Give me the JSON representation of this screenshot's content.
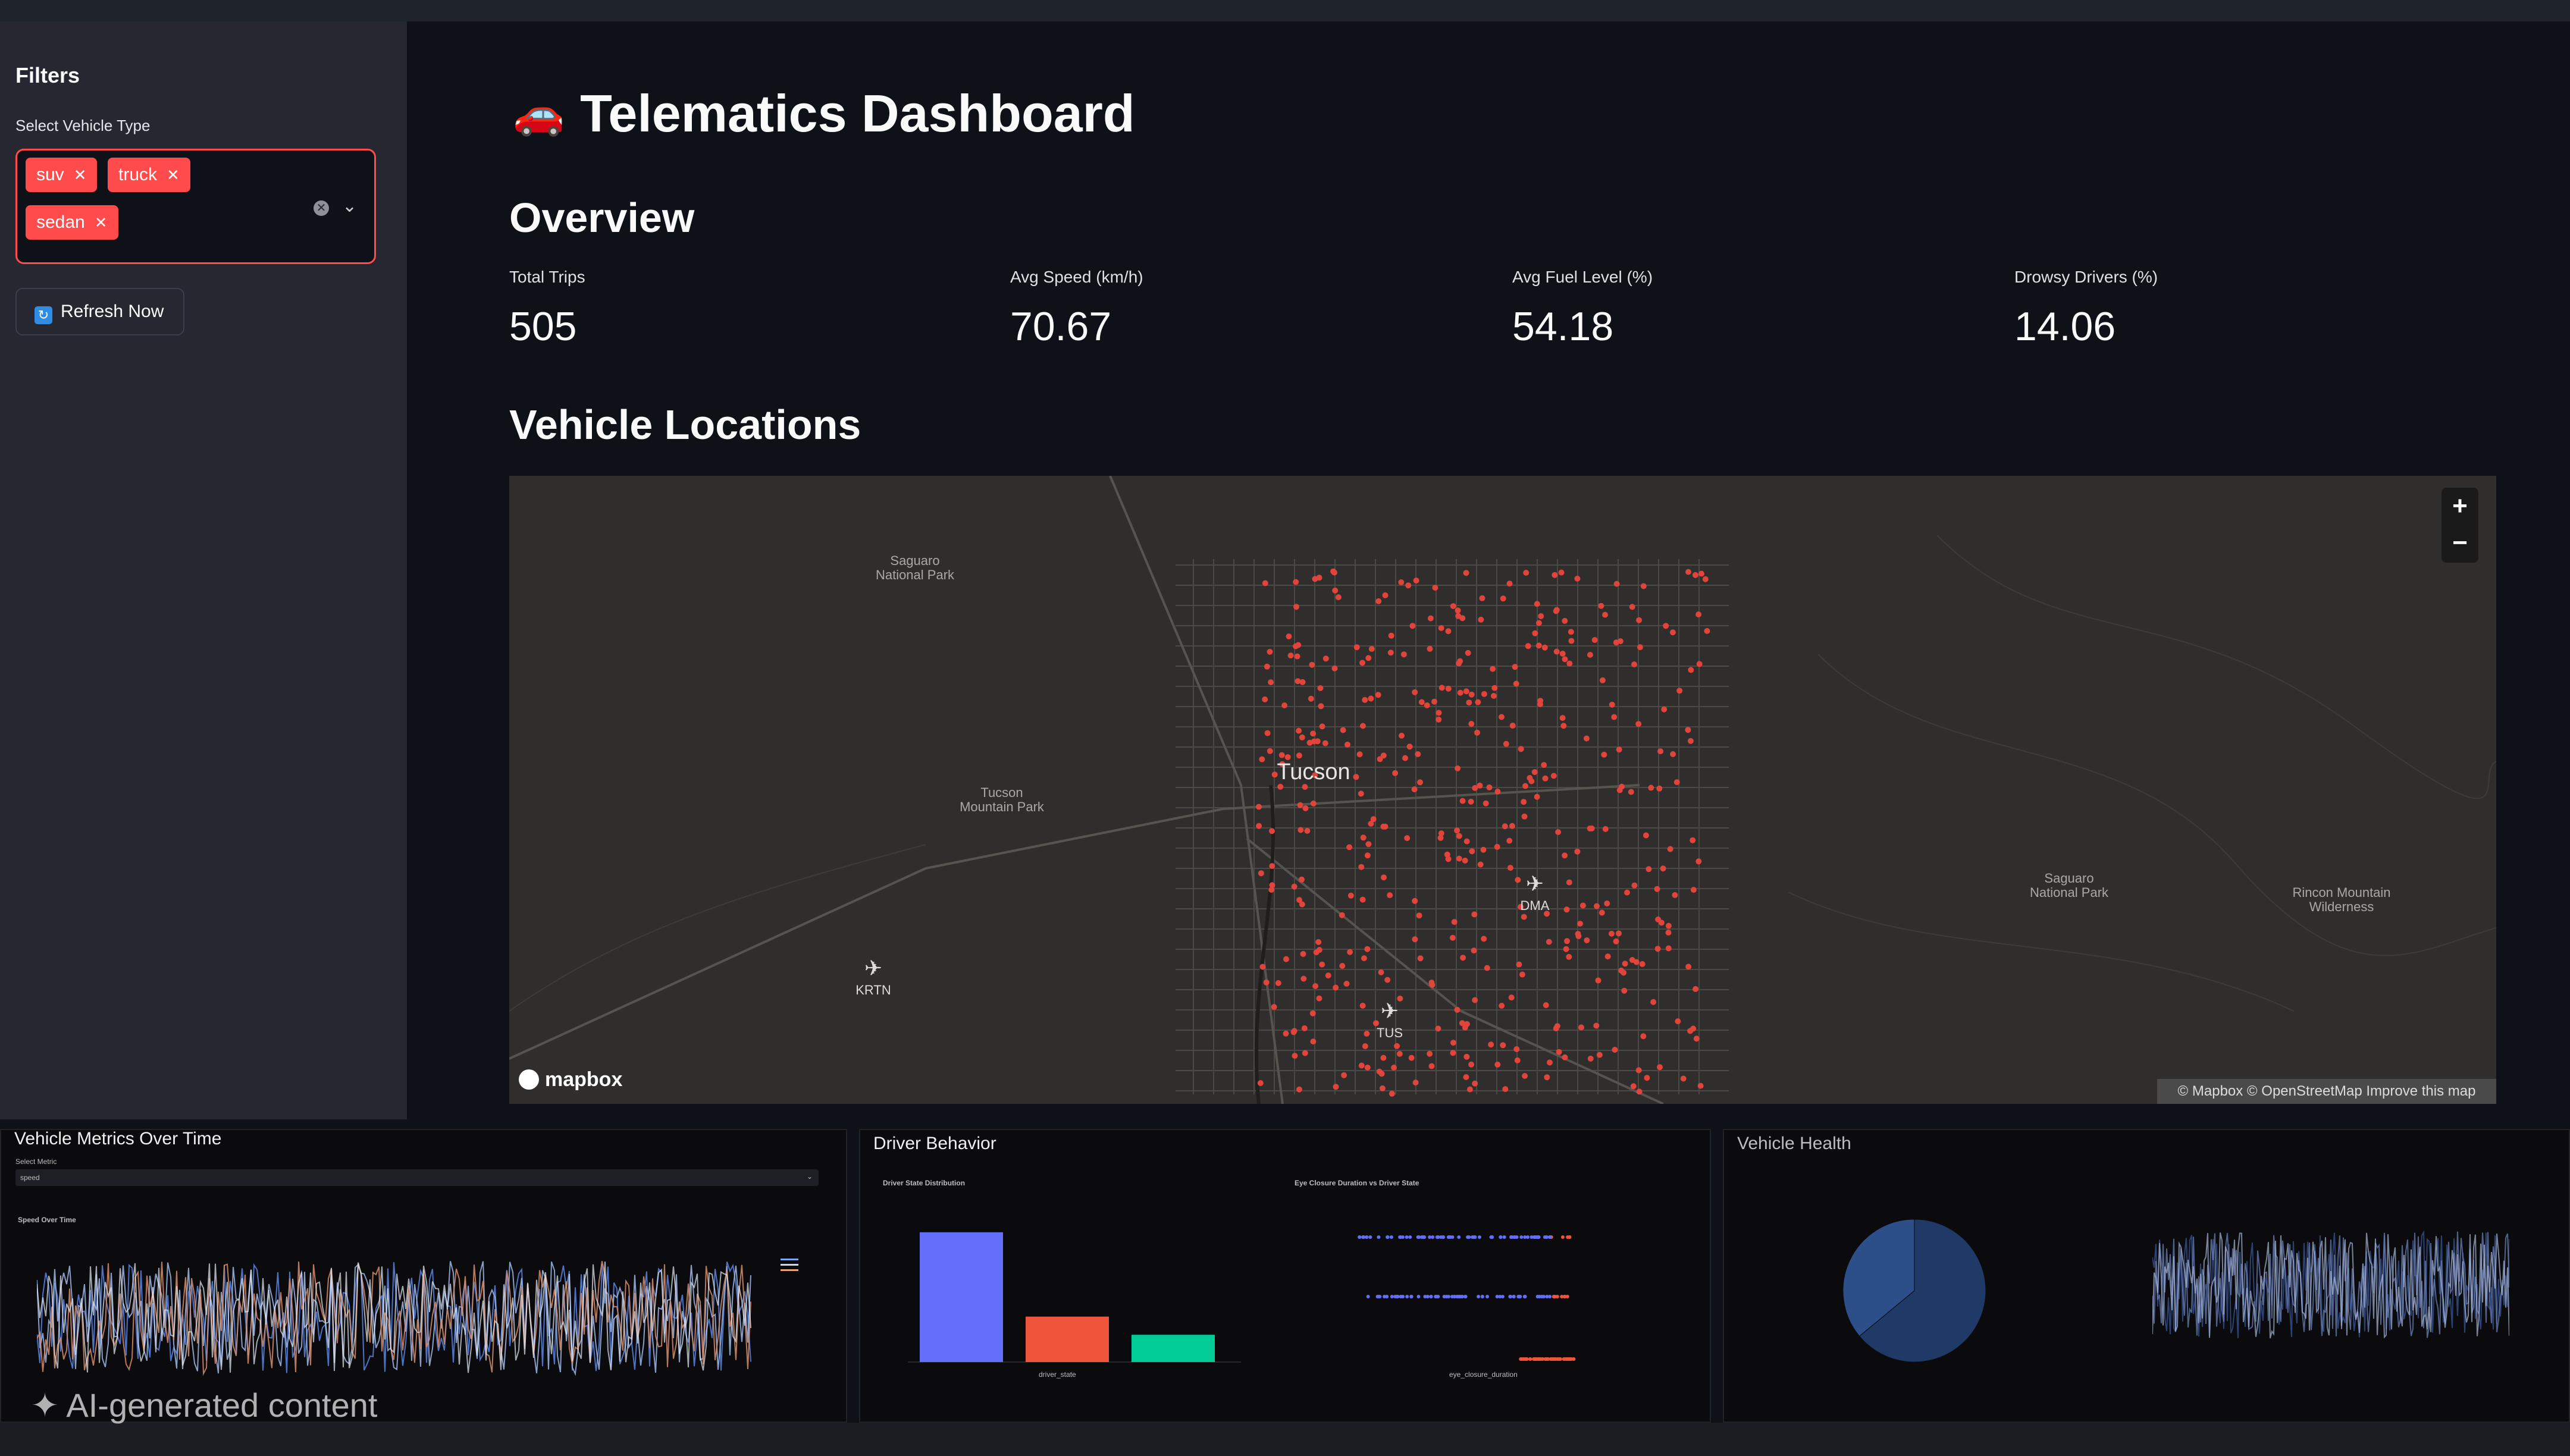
{
  "sidebar": {
    "title": "Filters",
    "select_label": "Select Vehicle Type",
    "selected_tags": [
      "suv",
      "truck",
      "sedan"
    ],
    "refresh_label": "Refresh Now"
  },
  "main": {
    "title": "Telematics Dashboard",
    "overview_heading": "Overview",
    "metrics": [
      {
        "label": "Total Trips",
        "value": "505"
      },
      {
        "label": "Avg Speed (km/h)",
        "value": "70.67"
      },
      {
        "label": "Avg Fuel Level (%)",
        "value": "54.18"
      },
      {
        "label": "Drowsy Drivers (%)",
        "value": "14.06"
      }
    ],
    "locations_heading": "Vehicle Locations"
  },
  "map": {
    "city": "Tucson",
    "places": [
      {
        "name": "Saguaro National Park",
        "lines": [
          "Saguaro",
          "National Park"
        ]
      },
      {
        "name": "Tucson Mountain Park",
        "lines": [
          "Tucson",
          "Mountain Park"
        ]
      },
      {
        "name": "Saguaro National Park",
        "lines": [
          "Saguaro",
          "National Park"
        ]
      },
      {
        "name": "Rincon Mountain Wilderness",
        "lines": [
          "Rincon Mountain",
          "Wilderness"
        ]
      }
    ],
    "airports": [
      "KRTN",
      "DMA",
      "TUS"
    ],
    "attribution": "© Mapbox © OpenStreetMap Improve this map",
    "logo": "mapbox",
    "zoom_in": "+",
    "zoom_out": "−",
    "point_color": "#e0443a"
  },
  "panels": {
    "metrics_over_time": {
      "title": "Vehicle Metrics Over Time",
      "select_label": "Select Metric",
      "select_value": "speed",
      "chart_title": "Speed Over Time"
    },
    "driver_behavior": {
      "title": "Driver Behavior",
      "left_chart_title": "Driver State Distribution",
      "right_chart_title": "Eye Closure Duration vs Driver State",
      "xlabel": "driver_state",
      "right_xlabel": "eye_closure_duration"
    },
    "vehicle_health": {
      "title": "Vehicle Health"
    }
  },
  "chart_data": [
    {
      "type": "bar",
      "title": "Driver State Distribution",
      "categories": [
        "",
        "",
        ""
      ],
      "values": [
        200,
        70,
        42
      ],
      "colors": [
        "#636efa",
        "#ef553b",
        "#00cc96"
      ]
    },
    {
      "type": "pie",
      "values": [
        64,
        36
      ],
      "colors": [
        "#1f3a66",
        "#2c4f8a"
      ]
    }
  ],
  "overlay": {
    "ai_label": "AI-generated content"
  }
}
